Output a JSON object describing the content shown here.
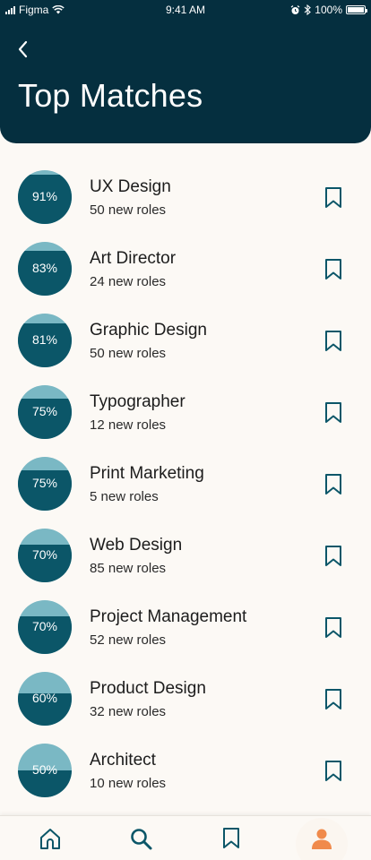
{
  "status_bar": {
    "carrier": "Figma",
    "time": "9:41 AM",
    "battery": "100%"
  },
  "header": {
    "title": "Top Matches"
  },
  "matches": [
    {
      "percent": "91%",
      "title": "UX Design",
      "subtitle": "50 new roles",
      "fraction": 0.91
    },
    {
      "percent": "83%",
      "title": "Art Director",
      "subtitle": "24 new roles",
      "fraction": 0.83
    },
    {
      "percent": "81%",
      "title": "Graphic Design",
      "subtitle": "50 new roles",
      "fraction": 0.81
    },
    {
      "percent": "75%",
      "title": "Typographer",
      "subtitle": "12 new roles",
      "fraction": 0.75
    },
    {
      "percent": "75%",
      "title": "Print Marketing",
      "subtitle": "5 new roles",
      "fraction": 0.75
    },
    {
      "percent": "70%",
      "title": "Web Design",
      "subtitle": "85 new roles",
      "fraction": 0.7
    },
    {
      "percent": "70%",
      "title": "Project Management",
      "subtitle": "52 new roles",
      "fraction": 0.7
    },
    {
      "percent": "60%",
      "title": "Product Design",
      "subtitle": "32 new roles",
      "fraction": 0.6
    },
    {
      "percent": "50%",
      "title": "Architect",
      "subtitle": "10 new roles",
      "fraction": 0.5
    }
  ],
  "tabbar": {
    "tabs": [
      {
        "icon": "home-icon"
      },
      {
        "icon": "search-icon"
      },
      {
        "icon": "bookmark-icon"
      },
      {
        "icon": "profile-icon"
      }
    ]
  },
  "colors": {
    "header_bg": "#052f3f",
    "circle_dark": "#0b5668",
    "circle_light": "#7ab8c4",
    "accent_teal": "#0b5668",
    "profile_orange": "#f08a4b",
    "background": "#fcf9f5"
  }
}
